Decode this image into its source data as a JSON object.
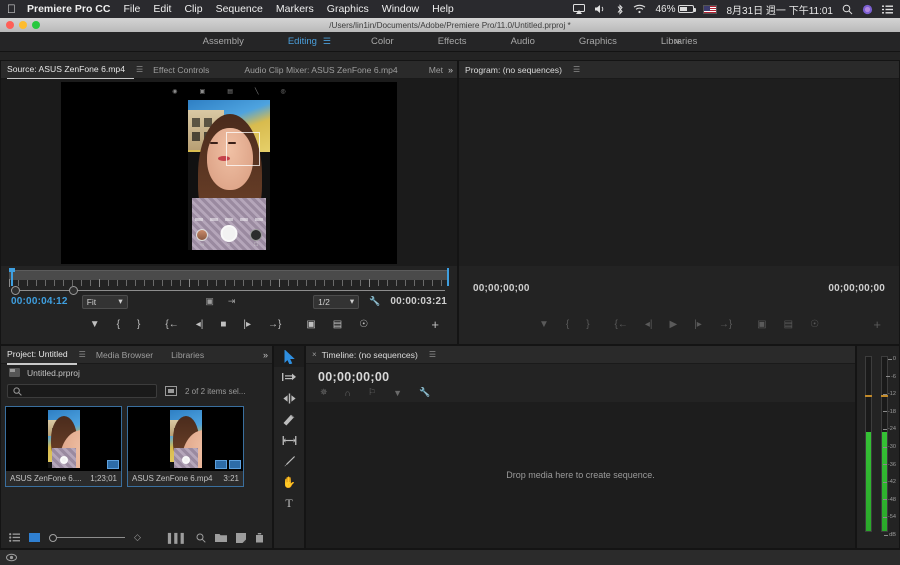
{
  "macmenu": {
    "apple_icon": "apple-icon",
    "app_name": "Premiere Pro CC",
    "items": [
      "File",
      "Edit",
      "Clip",
      "Sequence",
      "Markers",
      "Graphics",
      "Window",
      "Help"
    ],
    "status": {
      "airplay_icon": "airplay-icon",
      "volume_icon": "volume-icon",
      "bluetooth_icon": "bluetooth-icon",
      "wifi_icon": "wifi-icon",
      "battery_percent": "46%",
      "input_flag": "us-flag-icon",
      "datetime": "8月31日 週一 下午11:01",
      "search_icon": "search-icon",
      "siri_icon": "siri-icon",
      "notification_icon": "notification-center-icon"
    }
  },
  "titlebar": {
    "path": "/Users/lin1in/Documents/Adobe/Premiere Pro/11.0/Untitled.prproj *"
  },
  "workspaces": {
    "items": [
      "Assembly",
      "Editing",
      "Color",
      "Effects",
      "Audio",
      "Graphics",
      "Libraries"
    ],
    "active": "Editing",
    "overflow": "»"
  },
  "source_monitor": {
    "tabs": [
      "Source: ASUS ZenFone 6.mp4",
      "Effect Controls",
      "Audio Clip Mixer: ASUS ZenFone 6.mp4",
      "Met"
    ],
    "active_tab": "Source: ASUS ZenFone 6.mp4",
    "overflow": "»",
    "playhead_timecode": "00:00:04:12",
    "duration_timecode": "00:00:03:21",
    "fit_value": "Fit",
    "resolution_value": "1/2",
    "settings_icon": "wrench-icon",
    "export_frame_icon": "camera-icon",
    "transport": [
      "add-marker-icon",
      "mark-in-icon",
      "mark-out-icon",
      "go-to-in-icon",
      "step-back-icon",
      "play-stop-icon",
      "step-forward-icon",
      "go-to-out-icon",
      "insert-icon",
      "overwrite-icon",
      "export-frame-icon"
    ],
    "button_editor": "+"
  },
  "program_monitor": {
    "tab": "Program: (no sequences)",
    "playhead_timecode": "00;00;00;00",
    "duration_timecode": "00;00;00;00",
    "transport": [
      "add-marker-icon",
      "mark-in-icon",
      "mark-out-icon",
      "go-to-in-icon",
      "step-back-icon",
      "play-icon",
      "step-forward-icon",
      "go-to-out-icon",
      "lift-icon",
      "extract-icon",
      "export-frame-icon"
    ],
    "button_editor": "+"
  },
  "project_panel": {
    "tabs": [
      "Project: Untitled",
      "Media Browser",
      "Libraries"
    ],
    "active_tab": "Project: Untitled",
    "overflow": "»",
    "root_item": "Untitled.prproj",
    "search_placeholder": "",
    "search_value": "",
    "selection_status": "2 of 2 items sel...",
    "clips": [
      {
        "name": "ASUS ZenFone 6....",
        "duration": "1;23;01",
        "selected": true
      },
      {
        "name": "ASUS ZenFone 6.mp4",
        "duration": "3:21",
        "selected": true
      }
    ],
    "footer_icons": [
      "list-view-icon",
      "icon-view-icon",
      "zoom-slider",
      "sort-icon",
      "automate-to-sequence-icon",
      "find-icon",
      "new-bin-icon",
      "new-item-icon",
      "delete-icon"
    ]
  },
  "tools": [
    {
      "name": "selection-tool",
      "glyph": "➤",
      "active": true
    },
    {
      "name": "track-select-forward-tool",
      "glyph": "",
      "active": false
    },
    {
      "name": "ripple-edit-tool",
      "glyph": "",
      "active": false
    },
    {
      "name": "razor-tool",
      "glyph": "",
      "active": false
    },
    {
      "name": "slip-tool",
      "glyph": "",
      "active": false
    },
    {
      "name": "pen-tool",
      "glyph": "",
      "active": false
    },
    {
      "name": "hand-tool",
      "glyph": "✋",
      "active": false
    },
    {
      "name": "type-tool",
      "glyph": "T",
      "active": false
    }
  ],
  "timeline": {
    "close_label": "×",
    "tab": "Timeline: (no sequences)",
    "timecode": "00;00;00;00",
    "tool_icons": [
      "snap-icon",
      "linked-selection-icon",
      "marker-icon",
      "timeline-display-icon",
      "wrench-icon"
    ],
    "drop_hint": "Drop media here to create sequence."
  },
  "audio_meters": {
    "scale": [
      "0",
      "-6",
      "-12",
      "-18",
      "-24",
      "-30",
      "-36",
      "-42",
      "-48",
      "-54",
      "dB"
    ],
    "channels": [
      {
        "level_percent": 57
      },
      {
        "level_percent": 57
      }
    ]
  },
  "statusbar": {
    "icon": "drag-handle-icon"
  },
  "colors": {
    "accent_blue": "#3e9fe0",
    "panel_bg": "#232323",
    "tab_bg": "#2a2a2a",
    "meter_green": "#35c235",
    "selection_blue": "#3a6f9e"
  }
}
